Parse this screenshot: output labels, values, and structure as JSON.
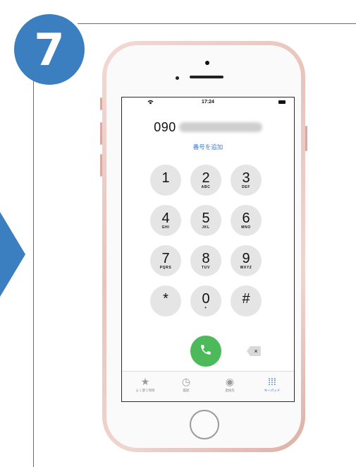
{
  "tutorial": {
    "step_number": "7",
    "accent_color": "#3b7fc0"
  },
  "status_bar": {
    "time": "17:24",
    "wifi_icon": "wifi-icon",
    "battery_icon": "battery-icon"
  },
  "dialer": {
    "entered_number_prefix": "090",
    "add_number_link": "番号を追加",
    "keys": [
      {
        "digit": "1",
        "letters": ""
      },
      {
        "digit": "2",
        "letters": "ABC"
      },
      {
        "digit": "3",
        "letters": "DEF"
      },
      {
        "digit": "4",
        "letters": "GHI"
      },
      {
        "digit": "5",
        "letters": "JKL"
      },
      {
        "digit": "6",
        "letters": "MNO"
      },
      {
        "digit": "7",
        "letters": "PQRS"
      },
      {
        "digit": "8",
        "letters": "TUV"
      },
      {
        "digit": "9",
        "letters": "WXYZ"
      },
      {
        "digit": "*",
        "letters": ""
      },
      {
        "digit": "0",
        "letters": "+"
      },
      {
        "digit": "#",
        "letters": ""
      }
    ],
    "call_icon": "phone-icon",
    "delete_symbol": "×",
    "call_color": "#4cb95a"
  },
  "tab_bar": {
    "tabs": [
      {
        "label": "よく使う項目",
        "icon": "star-icon",
        "glyph": "★"
      },
      {
        "label": "履歴",
        "icon": "clock-icon",
        "glyph": "◷"
      },
      {
        "label": "連絡先",
        "icon": "contact-icon",
        "glyph": "◉"
      },
      {
        "label": "キーパッド",
        "icon": "keypad-icon",
        "glyph": "⁞⁞⁞"
      }
    ],
    "active_index": 3,
    "active_color": "#2e6ad1"
  }
}
